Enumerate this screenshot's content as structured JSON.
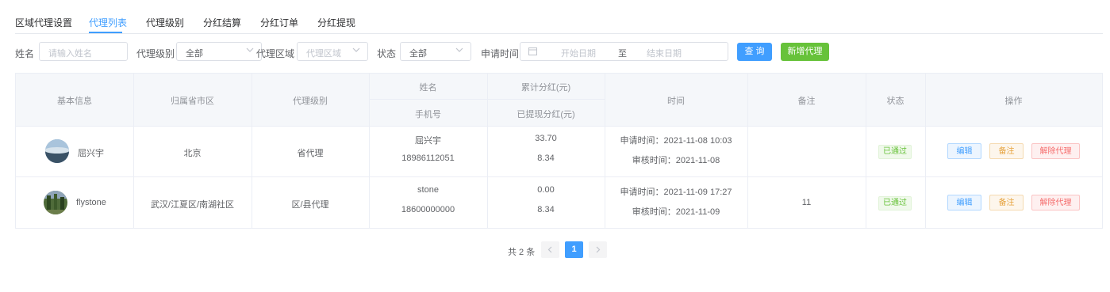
{
  "tabs": [
    {
      "label": "区域代理设置"
    },
    {
      "label": "代理列表"
    },
    {
      "label": "代理级别"
    },
    {
      "label": "分红结算"
    },
    {
      "label": "分红订单"
    },
    {
      "label": "分红提现"
    }
  ],
  "active_tab": "代理列表",
  "filters": {
    "name_label": "姓名",
    "name_placeholder": "请输入姓名",
    "level_label": "代理级别",
    "level_value": "全部",
    "region_label": "代理区域",
    "region_placeholder": "代理区域",
    "status_label": "状态",
    "status_value": "全部",
    "apply_time_label": "申请时间",
    "start_placeholder": "开始日期",
    "range_separator": "至",
    "end_placeholder": "结束日期",
    "query_button": "查 询",
    "add_button": "新增代理"
  },
  "table": {
    "headers": {
      "basic_info": "基本信息",
      "province_city": "归属省市区",
      "level": "代理级别",
      "name": "姓名",
      "phone": "手机号",
      "total_dividend": "累计分红(元)",
      "withdrawn_dividend": "已提现分红(元)",
      "time": "时间",
      "remark": "备注",
      "status": "状态",
      "actions": "操作"
    },
    "rows": [
      {
        "display_name": "屈兴宇",
        "region": "北京",
        "level": "省代理",
        "name": "屈兴宇",
        "phone": "18986112051",
        "total": "33.70",
        "withdrawn": "8.34",
        "apply_time": "申请时间：2021-11-08 10:03",
        "review_time": "审核时间：2021-11-08",
        "remark": "",
        "status": "已通过",
        "edit": "编辑",
        "note": "备注",
        "remove": "解除代理"
      },
      {
        "display_name": "flystone",
        "region": "武汉/江夏区/南湖社区",
        "level": "区/县代理",
        "name": "stone",
        "phone": "18600000000",
        "total": "0.00",
        "withdrawn": "8.34",
        "apply_time": "申请时间：2021-11-09 17:27",
        "review_time": "审核时间：2021-11-09",
        "remark": "11",
        "status": "已通过",
        "edit": "编辑",
        "note": "备注",
        "remove": "解除代理"
      }
    ]
  },
  "pagination": {
    "total_text": "共 2 条",
    "current_page": "1",
    "prev_icon": "chevron-left-icon",
    "next_icon": "chevron-right-icon"
  },
  "colors": {
    "primary": "#409eff",
    "success": "#67c23a",
    "warning": "#e6a23c",
    "danger": "#f56c6c"
  }
}
